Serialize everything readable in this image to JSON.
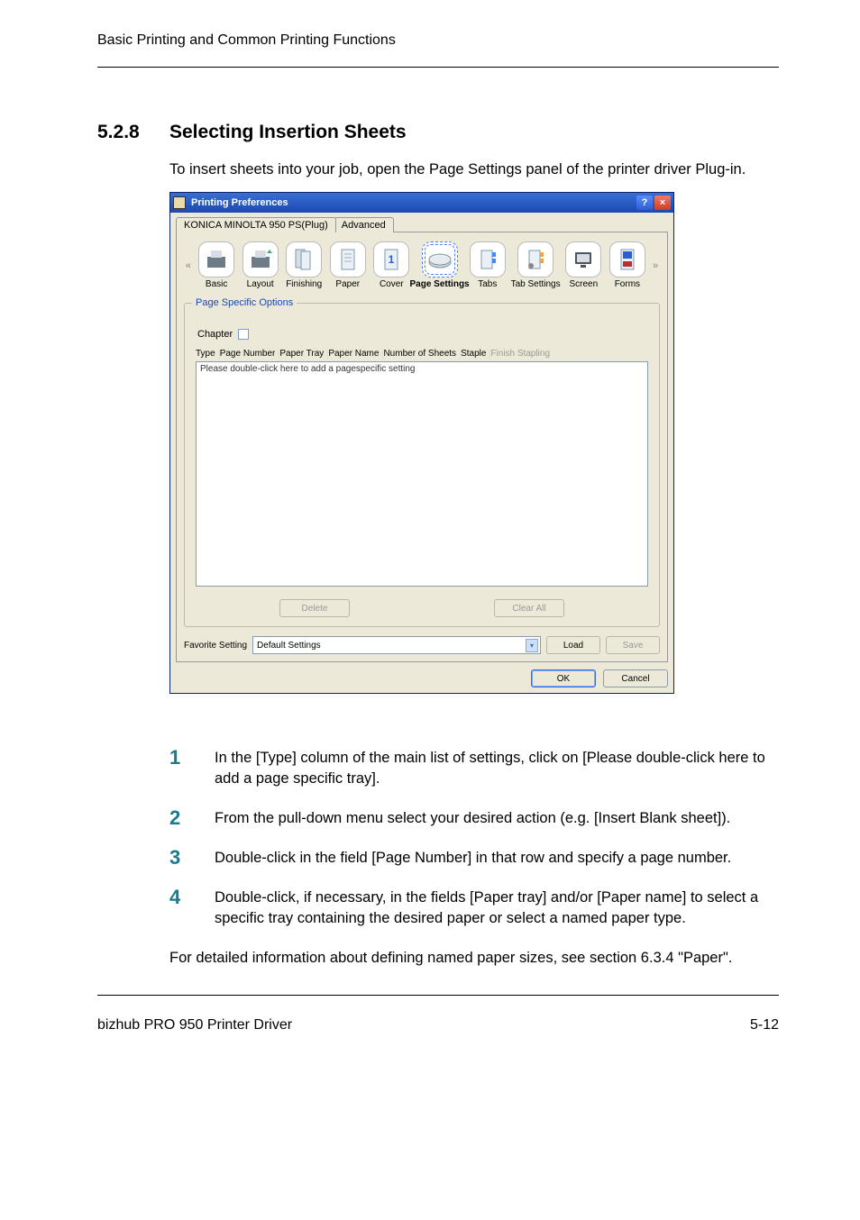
{
  "running_head": "Basic Printing and Common Printing Functions",
  "heading_num": "5.2.8",
  "heading_title": "Selecting Insertion Sheets",
  "intro": "To insert sheets into your job, open the Page Settings panel of the printer driver Plug-in.",
  "window": {
    "title_text": "Printing Preferences",
    "tab_main": "KONICA MINOLTA 950 PS(Plug)",
    "tab_adv": "Advanced",
    "panels": {
      "basic": "Basic",
      "layout": "Layout",
      "finishing": "Finishing",
      "paper": "Paper",
      "cover": "Cover",
      "page_settings": "Page Settings",
      "tabs": "Tabs",
      "tab_settings": "Tab Settings",
      "screen": "Screen",
      "forms": "Forms"
    },
    "arrow_left": "«",
    "arrow_right": "»",
    "group_legend": "Page Specific Options",
    "chapter_label": "Chapter",
    "columns": {
      "type": "Type",
      "page_number": "Page Number",
      "paper_tray": "Paper Tray",
      "paper_name": "Paper Name",
      "num_sheets": "Number of Sheets",
      "staple": "Staple",
      "finish_stapling": "Finish Stapling"
    },
    "list_placeholder": "Please double-click here to add a pagespecific setting",
    "delete_btn": "Delete",
    "clear_all_btn": "Clear All",
    "fav_label": "Favorite Setting",
    "fav_value": "Default Settings",
    "load_btn": "Load",
    "save_btn": "Save",
    "ok_btn": "OK",
    "cancel_btn": "Cancel",
    "help_glyph": "?",
    "close_glyph": "×",
    "dd_glyph": "▾"
  },
  "steps": {
    "s1": "In the [Type] column of the main list of settings, click on [Please double-click here to add a page specific tray].",
    "s2": "From the pull-down menu select your desired action (e.g. [Insert Blank sheet]).",
    "s3": "Double-click in the field [Page Number] in that row and specify a page number.",
    "s4": "Double-click, if necessary, in the fields [Paper tray] and/or [Paper name] to select a specific tray containing the desired paper or select a named paper type."
  },
  "n1": "1",
  "n2": "2",
  "n3": "3",
  "n4": "4",
  "trail": "For detailed information about defining named paper sizes, see section 6.3.4 \"Paper\".",
  "footer_left": "bizhub PRO 950 Printer Driver",
  "footer_right": "5-12"
}
